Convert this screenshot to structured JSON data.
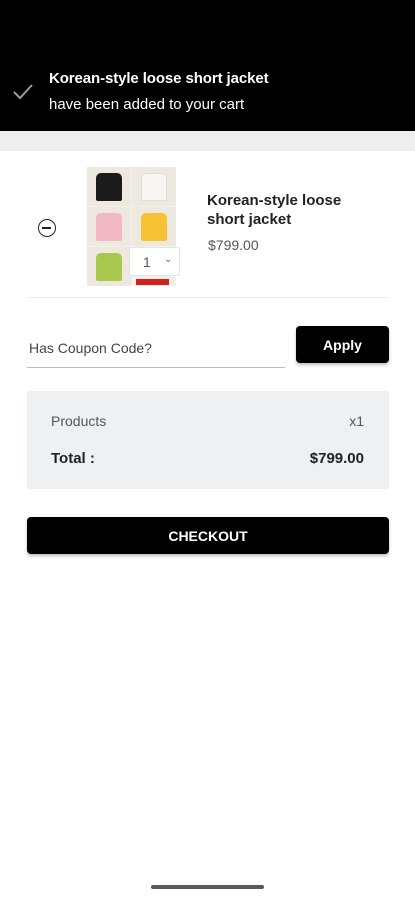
{
  "toast": {
    "title": "Korean-style loose short jacket",
    "message": "have been added to your cart",
    "icon": "check-icon"
  },
  "cart": {
    "items": [
      {
        "name": "Korean-style loose short jacket",
        "price": "$799.00",
        "quantity": "1",
        "image_colors": [
          "#1b1b1b",
          "#f3f1ec",
          "#f2b8c4",
          "#f4c233",
          "#a8c94e"
        ]
      }
    ]
  },
  "coupon": {
    "placeholder": "Has Coupon Code?",
    "value": "",
    "apply_label": "Apply"
  },
  "summary": {
    "products_label": "Products",
    "products_count": "x1",
    "total_label": "Total :",
    "total_value": "$799.00"
  },
  "checkout_label": "CHECKOUT",
  "colors": {
    "primary": "#000000",
    "summary_bg": "#eef0f1",
    "sale_red": "#d41e1e"
  }
}
